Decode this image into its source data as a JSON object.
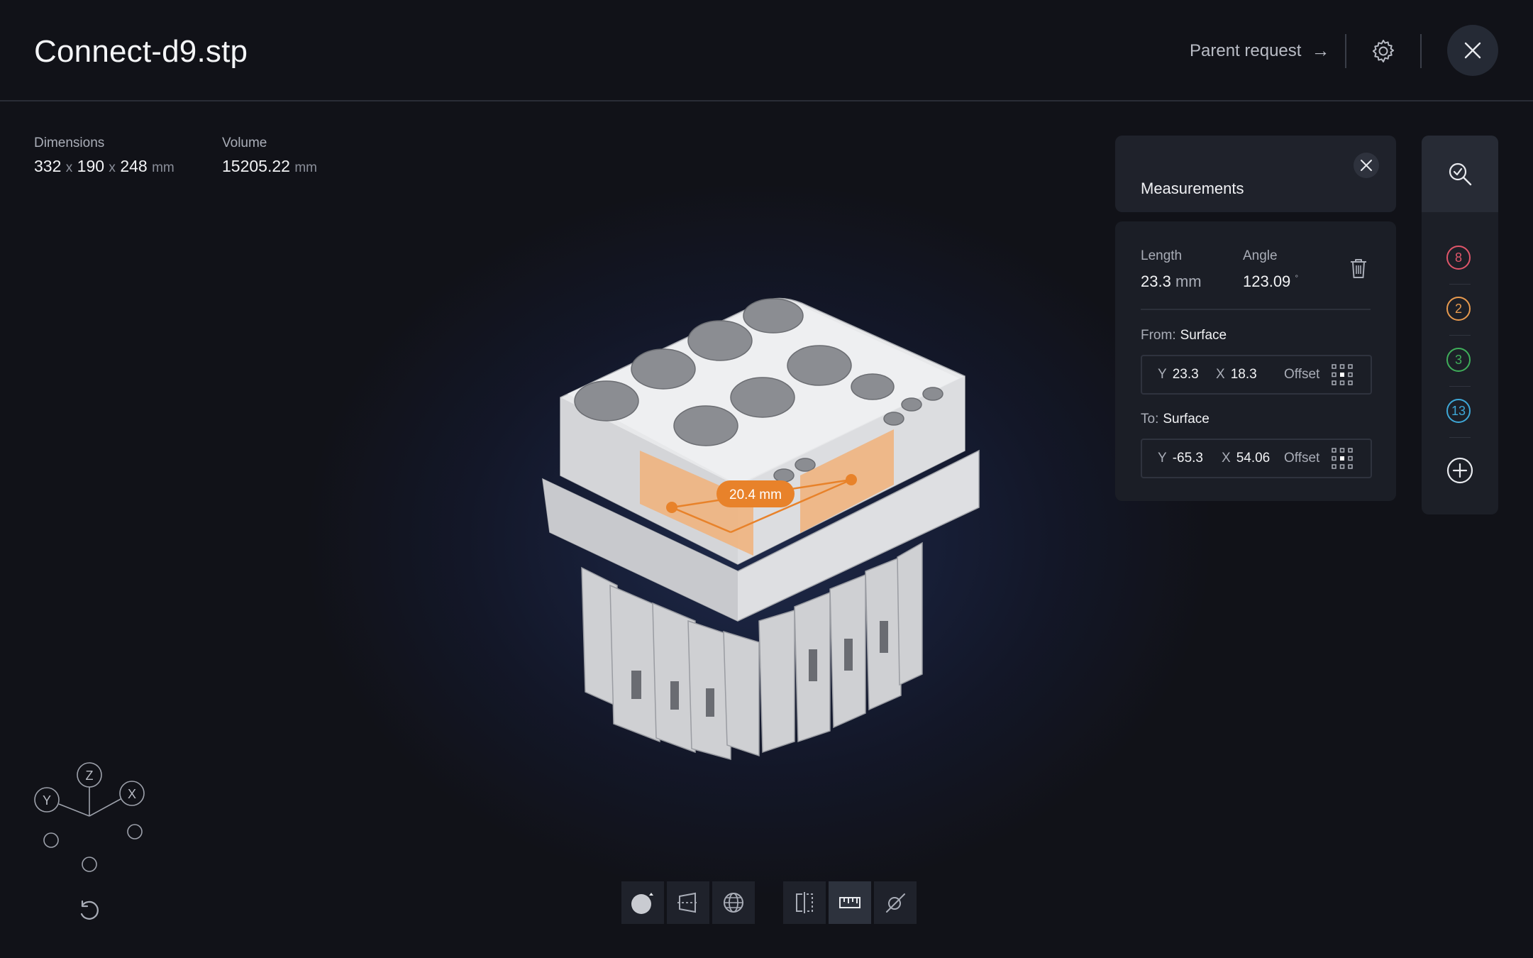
{
  "header": {
    "file_title": "Connect-d9.stp",
    "parent_request_label": "Parent request",
    "parent_request_arrow": "→"
  },
  "stats": {
    "dimensions_label": "Dimensions",
    "dim_x": "332",
    "dim_y": "190",
    "dim_z": "248",
    "dim_sep": "x",
    "dim_unit": "mm",
    "volume_label": "Volume",
    "volume_value": "15205.22",
    "volume_unit": "mm"
  },
  "viewer": {
    "measurement_label": "20.4 mm",
    "accent_color": "#e8822a"
  },
  "measurements": {
    "title": "Measurements",
    "length_label": "Length",
    "length_value": "23.3",
    "length_unit": "mm",
    "angle_label": "Angle",
    "angle_value": "123.09",
    "angle_unit": "°",
    "from_label": "From:",
    "from_value": "Surface",
    "from_y_axis": "Y",
    "from_y": "23.3",
    "from_x_axis": "X",
    "from_x": "18.3",
    "from_offset": "Offset",
    "to_label": "To:",
    "to_value": "Surface",
    "to_y_axis": "Y",
    "to_y": "-65.3",
    "to_x_axis": "X",
    "to_x": "54.06",
    "to_offset": "Offset"
  },
  "rail": {
    "badges": [
      {
        "count": "8",
        "color": "#e0566a"
      },
      {
        "count": "2",
        "color": "#e89a4e"
      },
      {
        "count": "3",
        "color": "#3fae5a"
      },
      {
        "count": "13",
        "color": "#3ea8d8"
      }
    ]
  },
  "gizmo": {
    "z": "Z",
    "y": "Y",
    "x": "X"
  },
  "toolbar": {
    "items": [
      "shading-icon",
      "section-plane-icon",
      "wireframe-globe-icon",
      "split-view-icon",
      "ruler-icon",
      "point-measure-icon"
    ],
    "active": "ruler-icon"
  }
}
